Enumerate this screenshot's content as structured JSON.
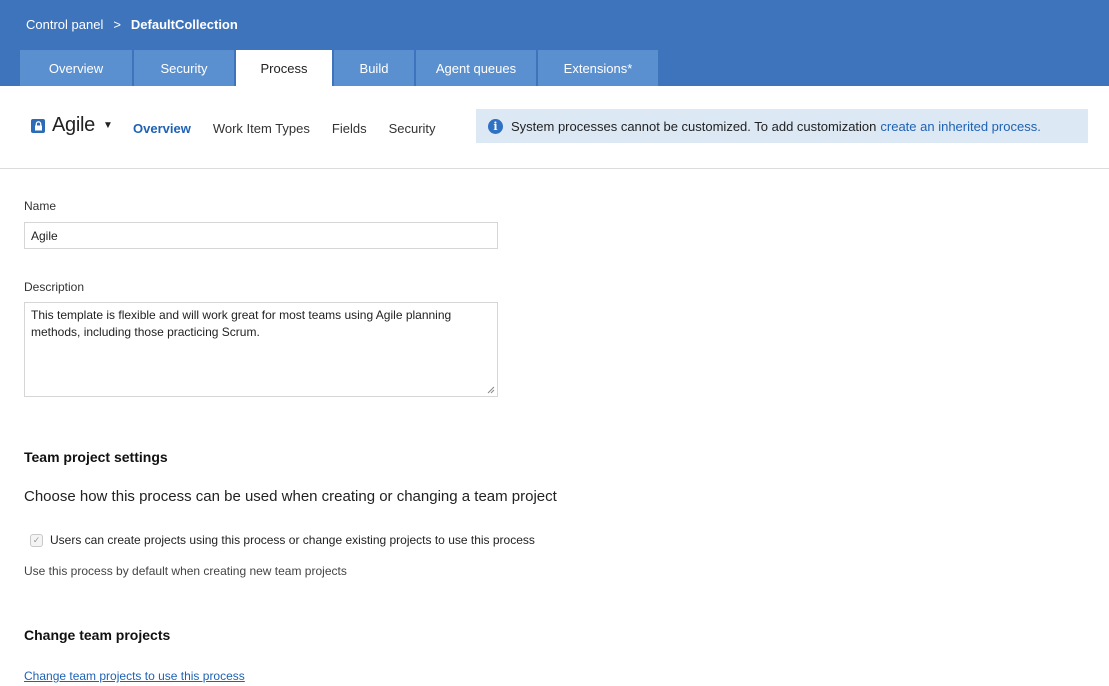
{
  "breadcrumb": {
    "root": "Control panel",
    "separator": ">",
    "current": "DefaultCollection"
  },
  "tabs": [
    {
      "label": "Overview",
      "active": false
    },
    {
      "label": "Security",
      "active": false
    },
    {
      "label": "Process",
      "active": true
    },
    {
      "label": "Build",
      "active": false
    },
    {
      "label": "Agent queues",
      "active": false
    },
    {
      "label": "Extensions*",
      "active": false
    }
  ],
  "process": {
    "name": "Agile",
    "icon": "lock-icon"
  },
  "subtabs": [
    {
      "label": "Overview",
      "active": true
    },
    {
      "label": "Work Item Types",
      "active": false
    },
    {
      "label": "Fields",
      "active": false
    },
    {
      "label": "Security",
      "active": false
    }
  ],
  "info": {
    "icon": "info-icon",
    "text": "System processes cannot be customized. To add customization",
    "link": "create an inherited process."
  },
  "form": {
    "name_label": "Name",
    "name_value": "Agile",
    "description_label": "Description",
    "description_value": "This template is flexible and will work great for most teams using Agile planning methods, including those practicing Scrum."
  },
  "team_settings": {
    "heading": "Team project settings",
    "subheading": "Choose how this process can be used when creating or changing a team project",
    "checkbox_label": "Users can create projects using this process or change existing projects to use this process",
    "checkbox_checked": true,
    "hint": "Use this process by default when creating new team projects"
  },
  "change_projects": {
    "heading": "Change team projects",
    "link": "Change team projects to use this process"
  },
  "colors": {
    "header": "#3e74bb",
    "tab": "#5a90d0",
    "accent": "#1f62b3",
    "banner": "#dce8f4"
  }
}
